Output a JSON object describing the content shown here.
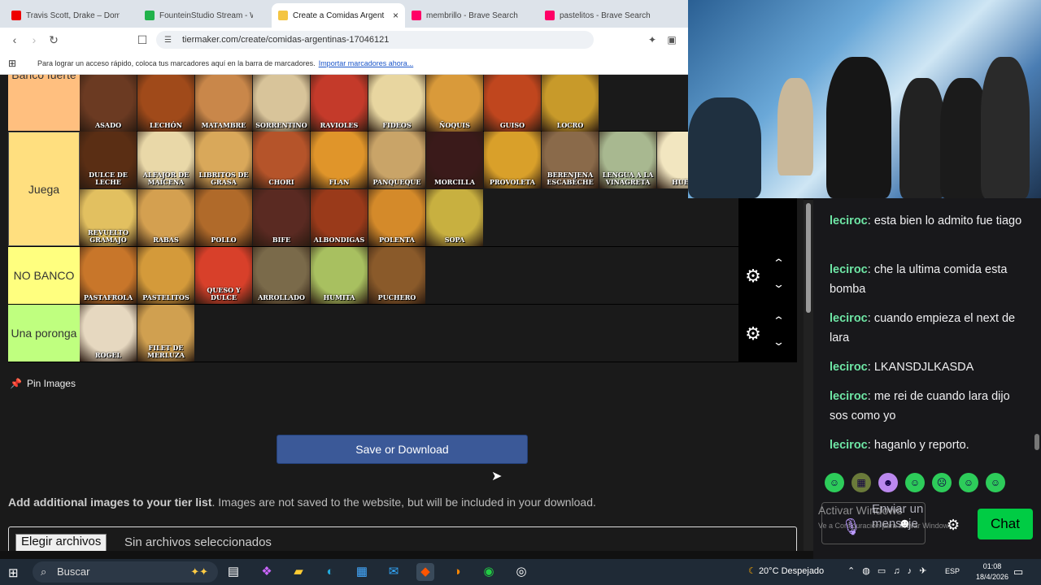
{
  "browser": {
    "tabs": [
      {
        "label": "Travis Scott, Drake – Dom",
        "fav": "#e00"
      },
      {
        "label": "FounteinStudio Stream - Wat",
        "fav": "#21b24b"
      },
      {
        "label": "Create a Comidas Argent",
        "fav": "#f4c542",
        "active": true
      },
      {
        "label": "membrillo - Brave Search",
        "fav": "#f06"
      },
      {
        "label": "pastelitos - Brave Search",
        "fav": "#f06"
      }
    ],
    "url": "tiermaker.com/create/comidas-argentinas-17046121",
    "bookmarks_text": "Para lograr un acceso rápido, coloca tus marcadores aquí en la barra de marcadores.",
    "bookmarks_link": "Importar marcadores ahora..."
  },
  "tierlist": {
    "tiers": [
      {
        "label": "Banco fuerte",
        "color": "#ffbf7f",
        "items": [
          {
            "name": "ASADO",
            "bg": "#6b3a22"
          },
          {
            "name": "LECHÓN",
            "bg": "#a04a1a"
          },
          {
            "name": "MATAMBRE",
            "bg": "#c9874a"
          },
          {
            "name": "SORRENTINO",
            "bg": "#d8c49a"
          },
          {
            "name": "RAVIOLES",
            "bg": "#c43a2a"
          },
          {
            "name": "FIDEOS",
            "bg": "#e8d6a0"
          },
          {
            "name": "ÑOQUIS",
            "bg": "#d99a3a"
          },
          {
            "name": "GUISO",
            "bg": "#c0461e"
          },
          {
            "name": "LOCRO",
            "bg": "#c89a2a"
          }
        ]
      },
      {
        "label": "Juega",
        "color": "#ffdf7f",
        "items": [
          {
            "name": "DULCE DE LECHE",
            "bg": "#5a2e14"
          },
          {
            "name": "ALFAJOR DE MAICENA",
            "bg": "#e9d8a8"
          },
          {
            "name": "LIBRITOS DE GRASA",
            "bg": "#d9a85a"
          },
          {
            "name": "CHORI",
            "bg": "#b5542a"
          },
          {
            "name": "FLAN",
            "bg": "#e0952a"
          },
          {
            "name": "PANQUEQUE",
            "bg": "#c9a468"
          },
          {
            "name": "MORCILLA",
            "bg": "#3a1a1a"
          },
          {
            "name": "PROVOLETA",
            "bg": "#d9a02a"
          },
          {
            "name": "BERENJENA ESCABECHE",
            "bg": "#8a6a4a"
          },
          {
            "name": "LENGUA A LA VINAGRETA",
            "bg": "#a8b890"
          },
          {
            "name": "HUEVO",
            "bg": "#f2e6c0"
          },
          {
            "name": "REVUELTO GRAMAJO",
            "bg": "#e2c060"
          },
          {
            "name": "RABAS",
            "bg": "#d4a050"
          },
          {
            "name": "POLLO",
            "bg": "#b06a2a"
          },
          {
            "name": "BIFE",
            "bg": "#5a2a22"
          },
          {
            "name": "ALBONDIGAS",
            "bg": "#9a3a1a"
          },
          {
            "name": "POLENTA",
            "bg": "#d48a2a"
          },
          {
            "name": "SOPA",
            "bg": "#c8b040"
          }
        ]
      },
      {
        "label": "NO BANCO",
        "color": "#ffff7f",
        "items": [
          {
            "name": "PASTAFROLA",
            "bg": "#c8762a"
          },
          {
            "name": "PASTELITOS",
            "bg": "#d49a3a"
          },
          {
            "name": "QUESO Y DULCE",
            "bg": "#d8402a"
          },
          {
            "name": "ARROLLADO",
            "bg": "#7a6a4a"
          },
          {
            "name": "HUMITA",
            "bg": "#a8c060"
          },
          {
            "name": "PUCHERO",
            "bg": "#8a5a2a"
          }
        ]
      },
      {
        "label": "Una poronga",
        "color": "#bfff7f",
        "items": [
          {
            "name": "ROGEL",
            "bg": "#e6d8c0"
          },
          {
            "name": "FILET DE MERLUZA",
            "bg": "#d0a050"
          }
        ]
      }
    ],
    "pin_label": "Pin Images",
    "save_label": "Save or Download",
    "add_title": "Add additional images to your tier list",
    "add_desc": ". Images are not saved to the website, but will be included in your download.",
    "file_button": "Elegir archivos",
    "file_status": "Sin archivos seleccionados"
  },
  "chat": {
    "messages": [
      {
        "user": "leciroc",
        "text": "esta bien lo admito fue tiago"
      },
      {
        "user": "leciroc",
        "text": "che la ultima comida esta bomba"
      },
      {
        "user": "leciroc",
        "text": "cuando empieza el next de lara"
      },
      {
        "user": "leciroc",
        "text": "LKANSDJLKASDA"
      },
      {
        "user": "leciroc",
        "text": "me rei de cuando lara dijo sos como yo"
      },
      {
        "user": "leciroc",
        "text": "haganlo y reporto."
      }
    ],
    "input_placeholder": "Enviar un mensaje",
    "chat_button": "Chat",
    "windows_watermark": "Activar Windows",
    "windows_watermark_sub": "Ve a Configuración para activar Windows."
  },
  "taskbar": {
    "search_label": "Buscar",
    "weather": "20°C  Despejado",
    "lang": "ESP",
    "time": "01:08",
    "date": "18/4/2026"
  }
}
